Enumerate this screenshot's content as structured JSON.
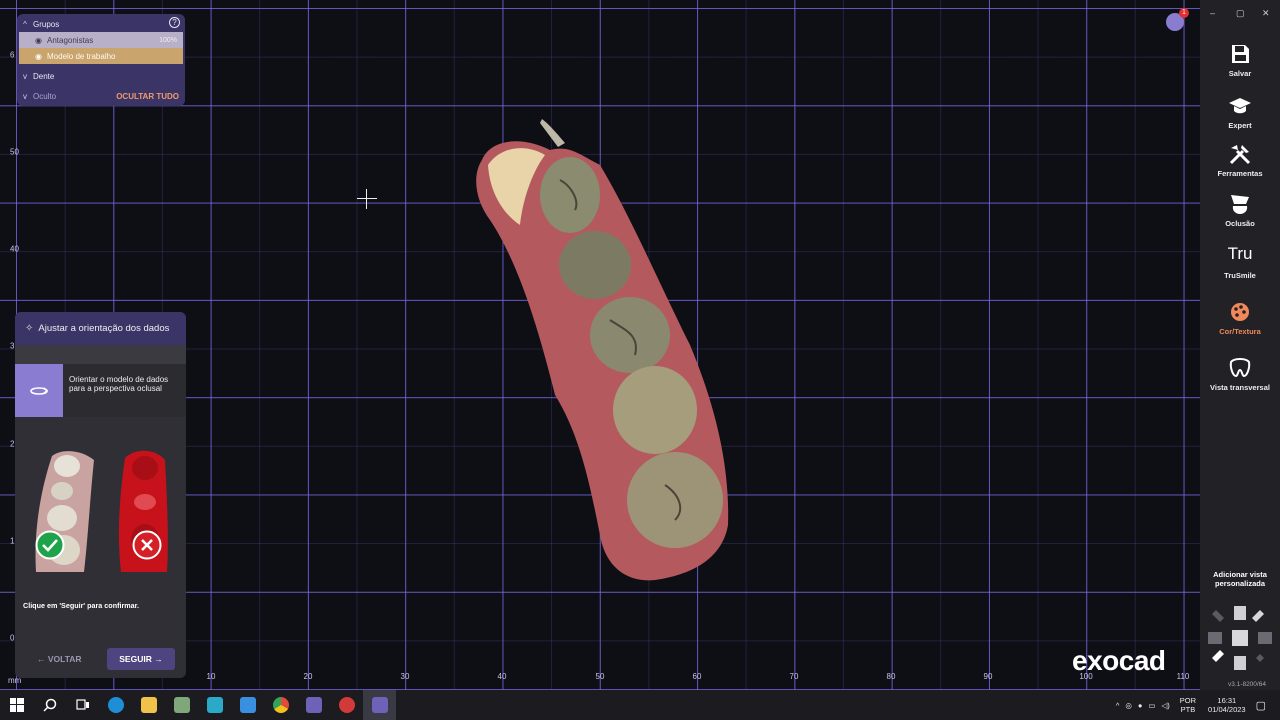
{
  "groups": {
    "title": "Grupos",
    "help_icon": "question-icon",
    "items": [
      {
        "label": "Antagonistas",
        "value": "100%"
      },
      {
        "label": "Modelo de trabalho",
        "value": ""
      }
    ],
    "dente_label": "Dente",
    "hidden_label": "Oculto",
    "hide_all_label": "OCULTAR TUDO"
  },
  "axis": {
    "unit": "mm",
    "x_ticks": [
      "10",
      "20",
      "30",
      "40",
      "50",
      "60",
      "70",
      "80",
      "90",
      "100",
      "110"
    ],
    "y_ticks": [
      "6",
      "50",
      "40",
      "3",
      "2",
      "1",
      "0"
    ]
  },
  "orientation_panel": {
    "title": "Ajustar a orientação dos dados",
    "step_text": "Orientar o modelo de dados para a perspectiva oclusal",
    "confirm_text": "Clique em 'Seguir' para confirmar.",
    "back_label": "VOLTAR",
    "next_label": "SEGUIR"
  },
  "sidebar": {
    "items": [
      {
        "label": "Salvar",
        "icon": "save-icon"
      },
      {
        "label": "Expert",
        "icon": "graduation-cap-icon"
      },
      {
        "label": "Ferramentas",
        "icon": "tools-icon"
      },
      {
        "label": "Oclusão",
        "icon": "occlusion-icon"
      },
      {
        "label": "TruSmile",
        "icon": "trusmile-icon",
        "icon_text": "Tru"
      },
      {
        "label": "Cor/Textura",
        "icon": "palette-icon"
      },
      {
        "label": "Vista transversal",
        "icon": "tooth-icon"
      }
    ],
    "custom_view_label": "Adicionar vista personalizada",
    "version": "v3.1-8200/64",
    "window_controls": [
      "–",
      "▢",
      "✕"
    ]
  },
  "notifications": {
    "count": "1"
  },
  "logo": "exocad",
  "taskbar": {
    "lang_top": "POR",
    "lang_bottom": "PTB",
    "time": "16:31",
    "date": "01/04/2023",
    "apps": [
      {
        "name": "start",
        "color": "#ffffff"
      },
      {
        "name": "search",
        "color": "#ffffff"
      },
      {
        "name": "task-view",
        "color": "#ffffff"
      },
      {
        "name": "edge",
        "color": "#1e8fd6"
      },
      {
        "name": "file-explorer",
        "color": "#f1c24a"
      },
      {
        "name": "app-green",
        "color": "#7fa87a"
      },
      {
        "name": "app-teal",
        "color": "#2aa9c9"
      },
      {
        "name": "app-blue",
        "color": "#3b8fe0"
      },
      {
        "name": "chrome",
        "color": "#e0b02a"
      },
      {
        "name": "exocad",
        "color": "#6d62b8"
      },
      {
        "name": "app-red",
        "color": "#d23a3a"
      },
      {
        "name": "dental-cad",
        "color": "#6d62b8"
      }
    ]
  }
}
